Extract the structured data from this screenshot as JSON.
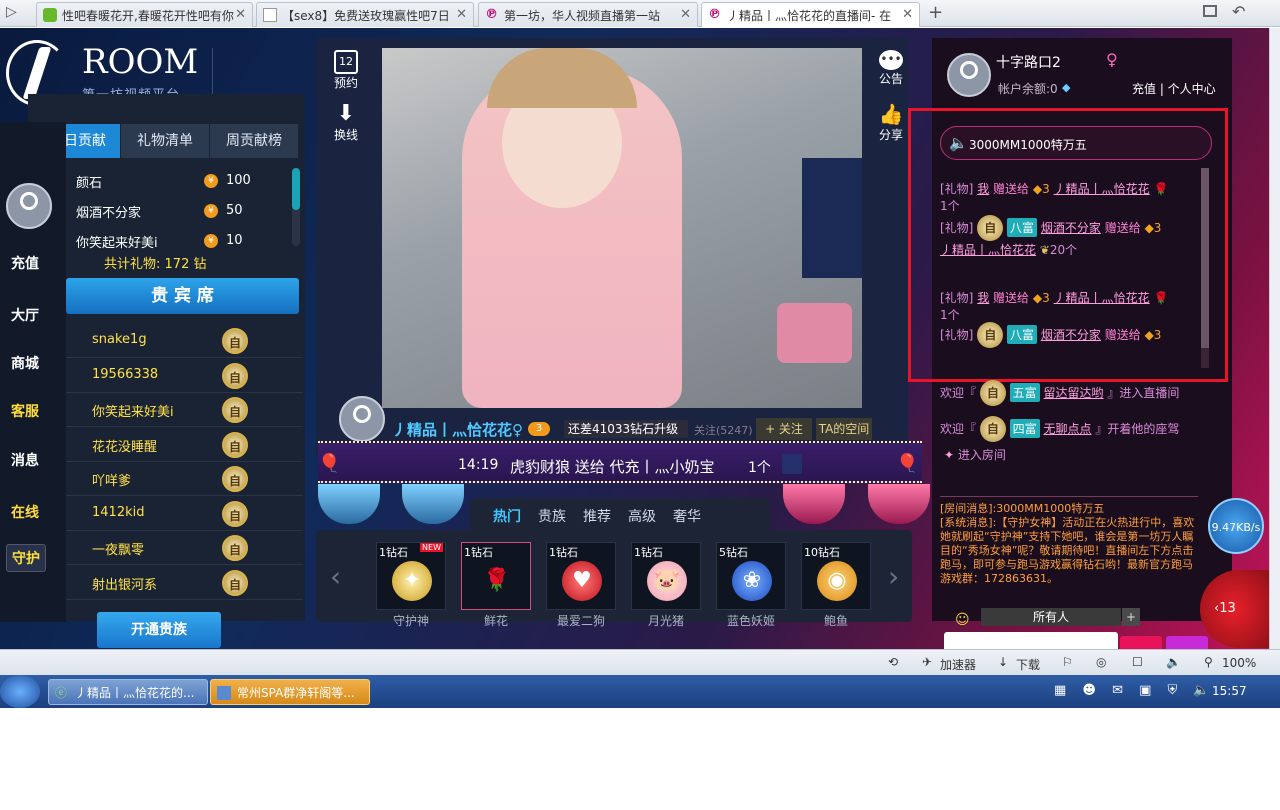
{
  "browser": {
    "tabs": [
      {
        "title": "性吧春暖花开,春暖花开性吧有你"
      },
      {
        "title": "【sex8】免费送玫瑰赢性吧7日"
      },
      {
        "title": "第一坊，华人视频直播第一站"
      },
      {
        "title": "丿精品丨灬恰花花的直播间- 在"
      }
    ],
    "new_tab": "+"
  },
  "logo": {
    "name": "ROOM",
    "subtitle": "第一坊视频平台"
  },
  "left_nav": [
    "充值",
    "大厅",
    "商城",
    "客服",
    "消息",
    "在线",
    "守护"
  ],
  "contrib": {
    "tabs": [
      "本日贡献",
      "礼物清单",
      "周贡献榜"
    ],
    "rows": [
      {
        "name": "颜石",
        "value": "100"
      },
      {
        "name": "烟酒不分家",
        "value": "50"
      },
      {
        "name": "你笑起来好美i",
        "value": "10"
      }
    ],
    "total_label": "共计礼物:",
    "total_value": "172",
    "total_unit": "钻"
  },
  "vip": {
    "title": "贵 宾 席",
    "badge": "自",
    "rows": [
      "snake1g",
      "19566338",
      "你笑起来好美i",
      "花花没睡醒",
      "吖咩爹",
      "1412kid",
      "一夜飘零",
      "射出银河系"
    ],
    "open_button": "开通贵族"
  },
  "video_side": {
    "book": "预约",
    "book_num": "12",
    "switch": "换线",
    "notice": "公告",
    "share": "分享"
  },
  "streamer": {
    "name": "丿精品丨灬恰花花♀",
    "level": "3",
    "upgrade": "还差41033钻石升级",
    "follow_count": "关注(5247)",
    "follow": "+ 关注",
    "space": "TA的空间"
  },
  "ticker": {
    "time": "14:19",
    "text": "虎豹财狼 送给 代充丨灬小奶宝",
    "count": "1个"
  },
  "gift_tabs": [
    "热门",
    "贵族",
    "推荐",
    "高级",
    "奢华"
  ],
  "gifts": [
    {
      "price": "1钻石",
      "name": "守护神",
      "new": "NEW"
    },
    {
      "price": "1钻石",
      "name": "鲜花"
    },
    {
      "price": "1钻石",
      "name": "最爱二狗"
    },
    {
      "price": "1钻石",
      "name": "月光猪"
    },
    {
      "price": "5钻石",
      "name": "蓝色妖姬"
    },
    {
      "price": "10钻石",
      "name": "鲍鱼"
    }
  ],
  "user": {
    "name": "十字路口2",
    "gender": "♀",
    "balance": "帐户余额:0",
    "recharge": "充值 | 个人中心"
  },
  "chat": {
    "speaker": "3000MM1000特万五",
    "lines": [
      {
        "tag": "[礼物]",
        "from": "我",
        "action": "赠送给",
        "to": "丿精品丨灬恰花花",
        "count": "1个"
      },
      {
        "tag": "[礼物]",
        "badge": "八富",
        "from": "烟酒不分家",
        "action": "赠送给",
        "to": "丿精品丨灬恰花花",
        "count": "20个"
      },
      {
        "tag": "[礼物]",
        "from": "我",
        "action": "赠送给",
        "to": "丿精品丨灬恰花花",
        "count": "1个"
      },
      {
        "tag": "[礼物]",
        "badge": "八富",
        "from": "烟酒不分家",
        "action": "赠送给"
      }
    ],
    "welcome": [
      {
        "prefix": "欢迎『",
        "badge": "五富",
        "name": "留达留达哟",
        "suffix": "』进入直播间"
      },
      {
        "prefix": "欢迎『",
        "badge": "四富",
        "name": "无聊点点",
        "suffix": "』开着他的座驾",
        "extra": "进入房间"
      }
    ],
    "badge_letter": "自"
  },
  "sysmsg": {
    "room_prefix": "[房间消息]:3000MM1000特万五",
    "system": "[系统消息]:【守护女神】活动正在火热进行中，喜欢她就刷起“守护神”支持下她吧，谁会是第一坊万人瞩目的“秀场女神”呢？敬请期待吧！直播间左下方点击跑马，即可参与跑马游戏赢得钻石哟！最新官方跑马游戏群：172863631。"
  },
  "recipient": "所有人",
  "speed": "9.47KB/s",
  "fold_count": "13",
  "statusbar": {
    "accelerator": "加速器",
    "download": "下载",
    "zoom": "100%"
  },
  "taskbar": {
    "items": [
      "丿精品丨灬恰花花的...",
      "常州SPA群净轩阁等..."
    ],
    "time": "15:57"
  },
  "colors": {
    "accent": "#1d88d6",
    "pink": "#ff7fd0",
    "gold": "#ffe14a"
  }
}
